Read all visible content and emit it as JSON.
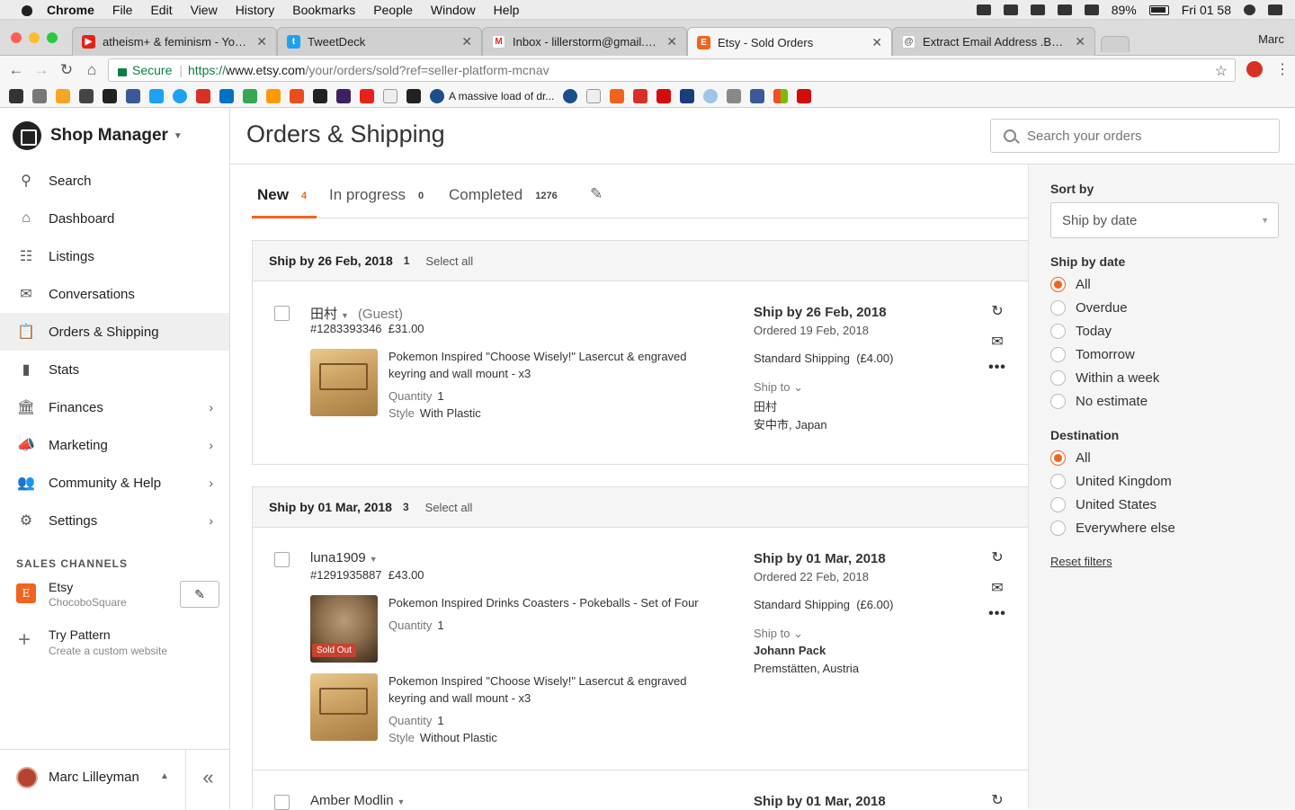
{
  "os_menubar": {
    "app_name": "Chrome",
    "menus": [
      "File",
      "Edit",
      "View",
      "History",
      "Bookmarks",
      "People",
      "Window",
      "Help"
    ],
    "battery": "89%",
    "clock": "Fri 01 58"
  },
  "browser": {
    "tabs": [
      {
        "title": "atheism+ & feminism - YouTube",
        "icon": "youtube-icon",
        "color": "#e62117"
      },
      {
        "title": "TweetDeck",
        "icon": "tweetdeck-icon",
        "color": "#1da1f2"
      },
      {
        "title": "Inbox - lillerstorm@gmail.com",
        "icon": "gmail-icon",
        "color": "#d93025"
      },
      {
        "title": "Etsy - Sold Orders",
        "icon": "etsy-icon",
        "color": "#f1641e"
      },
      {
        "title": "Extract Email Address .Best Email",
        "icon": "at-sign-icon",
        "color": "#555555"
      }
    ],
    "profile": "Marc",
    "secure_label": "Secure",
    "url_scheme": "https://",
    "url_host": "www.etsy.com",
    "url_path": "/your/orders/sold?ref=seller-platform-mcnav",
    "bookmark_text": "A massive load of dr..."
  },
  "sidebar": {
    "shop_title": "Shop Manager",
    "nav": [
      {
        "label": "Search",
        "icon": "search-icon"
      },
      {
        "label": "Dashboard",
        "icon": "home-icon"
      },
      {
        "label": "Listings",
        "icon": "listings-icon"
      },
      {
        "label": "Conversations",
        "icon": "mail-icon"
      },
      {
        "label": "Orders & Shipping",
        "icon": "clipboard-icon"
      },
      {
        "label": "Stats",
        "icon": "bar-chart-icon"
      },
      {
        "label": "Finances",
        "icon": "bank-icon"
      },
      {
        "label": "Marketing",
        "icon": "megaphone-icon"
      },
      {
        "label": "Community & Help",
        "icon": "people-icon"
      },
      {
        "label": "Settings",
        "icon": "gear-icon"
      }
    ],
    "sales_channels_label": "SALES CHANNELS",
    "etsy_channel": {
      "name": "Etsy",
      "shop": "ChocoboSquare"
    },
    "try_pattern": {
      "name": "Try Pattern",
      "sub": "Create a custom website"
    },
    "user_name": "Marc Lilleyman"
  },
  "header": {
    "title": "Orders & Shipping",
    "search_placeholder": "Search your orders"
  },
  "tabs": [
    {
      "label": "New",
      "count": "4"
    },
    {
      "label": "In progress",
      "count": "0"
    },
    {
      "label": "Completed",
      "count": "1276"
    }
  ],
  "groups": [
    {
      "title": "Ship by 26 Feb, 2018",
      "count": "1",
      "select_all": "Select all",
      "order": {
        "buyer": "田村",
        "guest": "(Guest)",
        "id": "#1283393346",
        "total": "£31.00",
        "items": [
          {
            "title": "Pokemon Inspired \"Choose Wisely!\" Lasercut & engraved keyring and wall mount - x3",
            "quantity_label": "Quantity",
            "quantity": "1",
            "style_label": "Style",
            "style": "With Plastic"
          }
        ],
        "ship_by": "Ship by 26 Feb, 2018",
        "ordered": "Ordered 19 Feb, 2018",
        "shipping": "Standard Shipping",
        "shipping_cost": "(£4.00)",
        "ship_to_label": "Ship to",
        "recipient": "田村",
        "location": "安中市, Japan"
      }
    },
    {
      "title": "Ship by 01 Mar, 2018",
      "count": "3",
      "select_all": "Select all",
      "order": {
        "buyer": "luna1909",
        "id": "#1291935887",
        "total": "£43.00",
        "items": [
          {
            "title": "Pokemon Inspired Drinks Coasters - Pokeballs - Set of Four",
            "quantity_label": "Quantity",
            "quantity": "1",
            "badge": "Sold Out"
          },
          {
            "title": "Pokemon Inspired \"Choose Wisely!\" Lasercut & engraved keyring and wall mount - x3",
            "quantity_label": "Quantity",
            "quantity": "1",
            "style_label": "Style",
            "style": "Without Plastic"
          }
        ],
        "ship_by": "Ship by 01 Mar, 2018",
        "ordered": "Ordered 22 Feb, 2018",
        "shipping": "Standard Shipping",
        "shipping_cost": "(£6.00)",
        "ship_to_label": "Ship to",
        "recipient": "Johann Pack",
        "location": "Premstätten, Austria"
      },
      "next_order": {
        "buyer": "Amber Modlin",
        "ship_by": "Ship by 01 Mar, 2018"
      }
    }
  ],
  "filters": {
    "sort_label": "Sort by",
    "sort_value": "Ship by date",
    "ship_by_label": "Ship by date",
    "ship_by_options": [
      "All",
      "Overdue",
      "Today",
      "Tomorrow",
      "Within a week",
      "No estimate"
    ],
    "destination_label": "Destination",
    "destination_options": [
      "All",
      "United Kingdom",
      "United States",
      "Everywhere else"
    ],
    "reset": "Reset filters",
    "accent": "#f1641e"
  }
}
